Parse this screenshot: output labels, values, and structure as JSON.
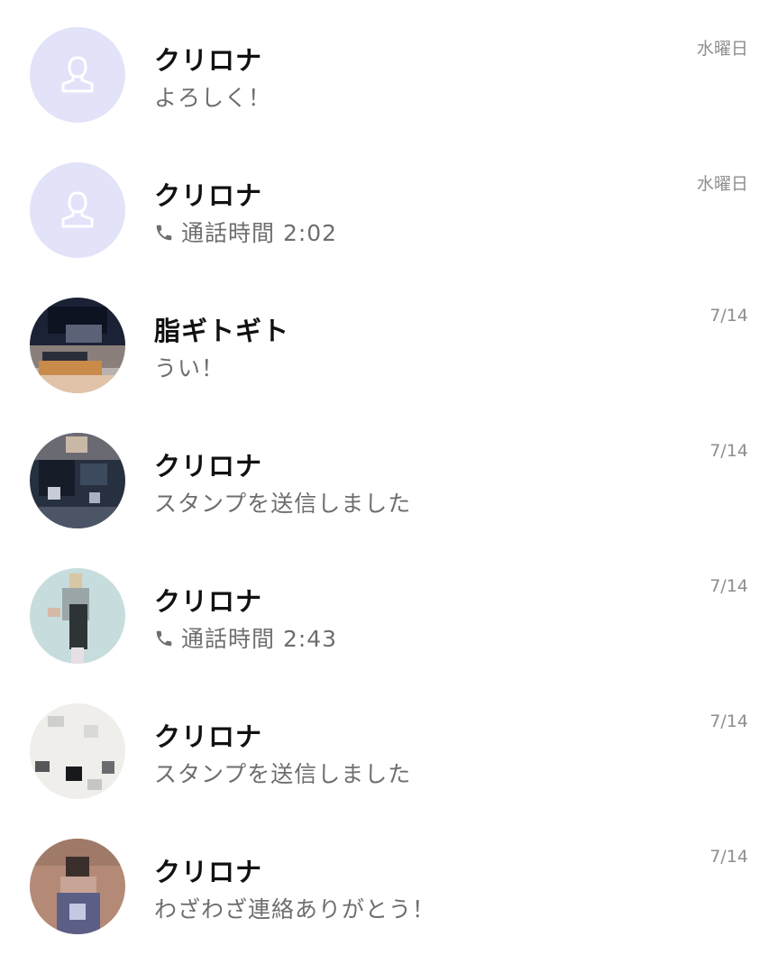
{
  "chats": [
    {
      "name": "クリロナ",
      "preview": "よろしく！",
      "date": "水曜日",
      "avatar": "default-user-icon"
    },
    {
      "name": "クリロナ",
      "preview": "通話時間 2:02",
      "date": "水曜日",
      "avatar": "default-user-icon",
      "preview_icon": "phone-icon"
    },
    {
      "name": "脂ギトギト",
      "preview": "うい！",
      "date": "7/14",
      "avatar": "user-photo"
    },
    {
      "name": "クリロナ",
      "preview": "スタンプを送信しました",
      "date": "7/14",
      "avatar": "user-photo"
    },
    {
      "name": "クリロナ",
      "preview": "通話時間 2:43",
      "date": "7/14",
      "avatar": "user-photo",
      "preview_icon": "phone-icon"
    },
    {
      "name": "クリロナ",
      "preview": "スタンプを送信しました",
      "date": "7/14",
      "avatar": "user-photo"
    },
    {
      "name": "クリロナ",
      "preview": "わざわざ連絡ありがとう！",
      "date": "7/14",
      "avatar": "user-photo"
    }
  ],
  "colors": {
    "default_avatar_bg": "#e2e3f9",
    "name_text": "#111111",
    "preview_text": "#6e6e6e",
    "date_text": "#8e8e8e"
  }
}
